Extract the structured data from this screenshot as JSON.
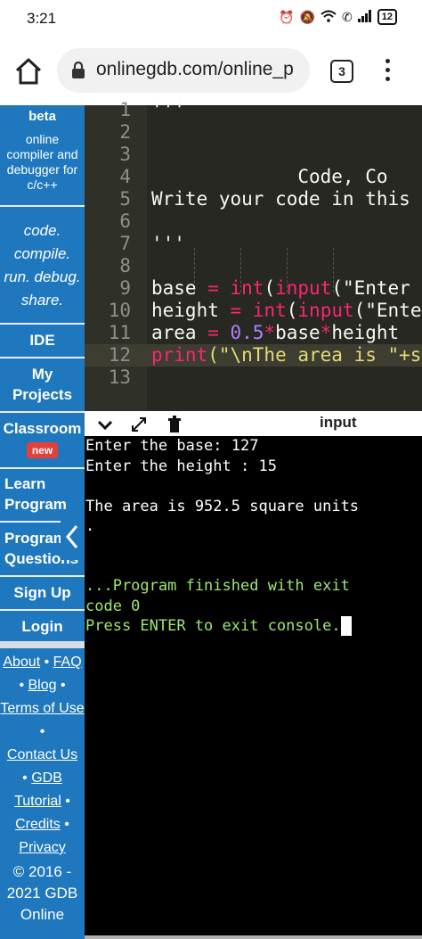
{
  "status_bar": {
    "time": "3:21",
    "battery": "12"
  },
  "browser": {
    "url": "onlinegdb.com/online_p",
    "tab_count": "3"
  },
  "sidebar": {
    "beta": "beta",
    "description": [
      "online",
      "compiler and",
      "debugger for",
      "c/c++"
    ],
    "motto": [
      "code.",
      "compile.",
      "run. debug.",
      "share."
    ],
    "nav": [
      {
        "label": "IDE"
      },
      {
        "label": "My\nProjects"
      },
      {
        "label": "Classroom",
        "badge": "new"
      },
      {
        "label": "Learn\nProgram"
      },
      {
        "label": "Program\nQuestions"
      },
      {
        "label": "Sign Up"
      },
      {
        "label": "Login"
      }
    ],
    "footer": {
      "about": "About",
      "faq": "FAQ",
      "blog": "Blog",
      "terms": "Terms of Use",
      "contact": "Contact Us",
      "gdb_tutorial": "GDB Tutorial",
      "credits": "Credits",
      "privacy": "Privacy",
      "copyright": "© 2016 - 2021 GDB Online"
    }
  },
  "editor": {
    "line_numbers": [
      "1",
      "2",
      "3",
      "4",
      "5",
      "6",
      "7",
      "8",
      "9",
      "10",
      "11",
      "12",
      "13"
    ],
    "lines": {
      "l1": "'''",
      "l4": "             Code, Co",
      "l5": "Write your code in this",
      "l7": "'''",
      "l9_a": "base ",
      "l9_b": "= ",
      "l9_c": "int",
      "l9_d": "(",
      "l9_e": "input",
      "l9_f": "(\"Enter",
      "l10_a": "height ",
      "l10_b": "= ",
      "l10_c": "int",
      "l10_d": "(",
      "l10_e": "input",
      "l10_f": "(\"Ente",
      "l11_a": "area ",
      "l11_b": "= ",
      "l11_c": "0.5",
      "l11_d": "*",
      "l11_e": "base",
      "l11_f": "*",
      "l11_g": "height",
      "l12_a": "print",
      "l12_b": "(\"\\nThe area is \"+s"
    }
  },
  "console": {
    "header_label": "input",
    "lines": [
      "Enter the base: 127",
      "Enter the height : 15",
      "",
      "The area is 952.5 square units",
      ".",
      "",
      "",
      "...Program finished with exit",
      "code 0",
      "Press ENTER to exit console."
    ]
  },
  "colors": {
    "sidebar": "#1f78bd",
    "editor_bg": "#272822",
    "console_bg": "#000000",
    "console_green": "#9fe870"
  }
}
